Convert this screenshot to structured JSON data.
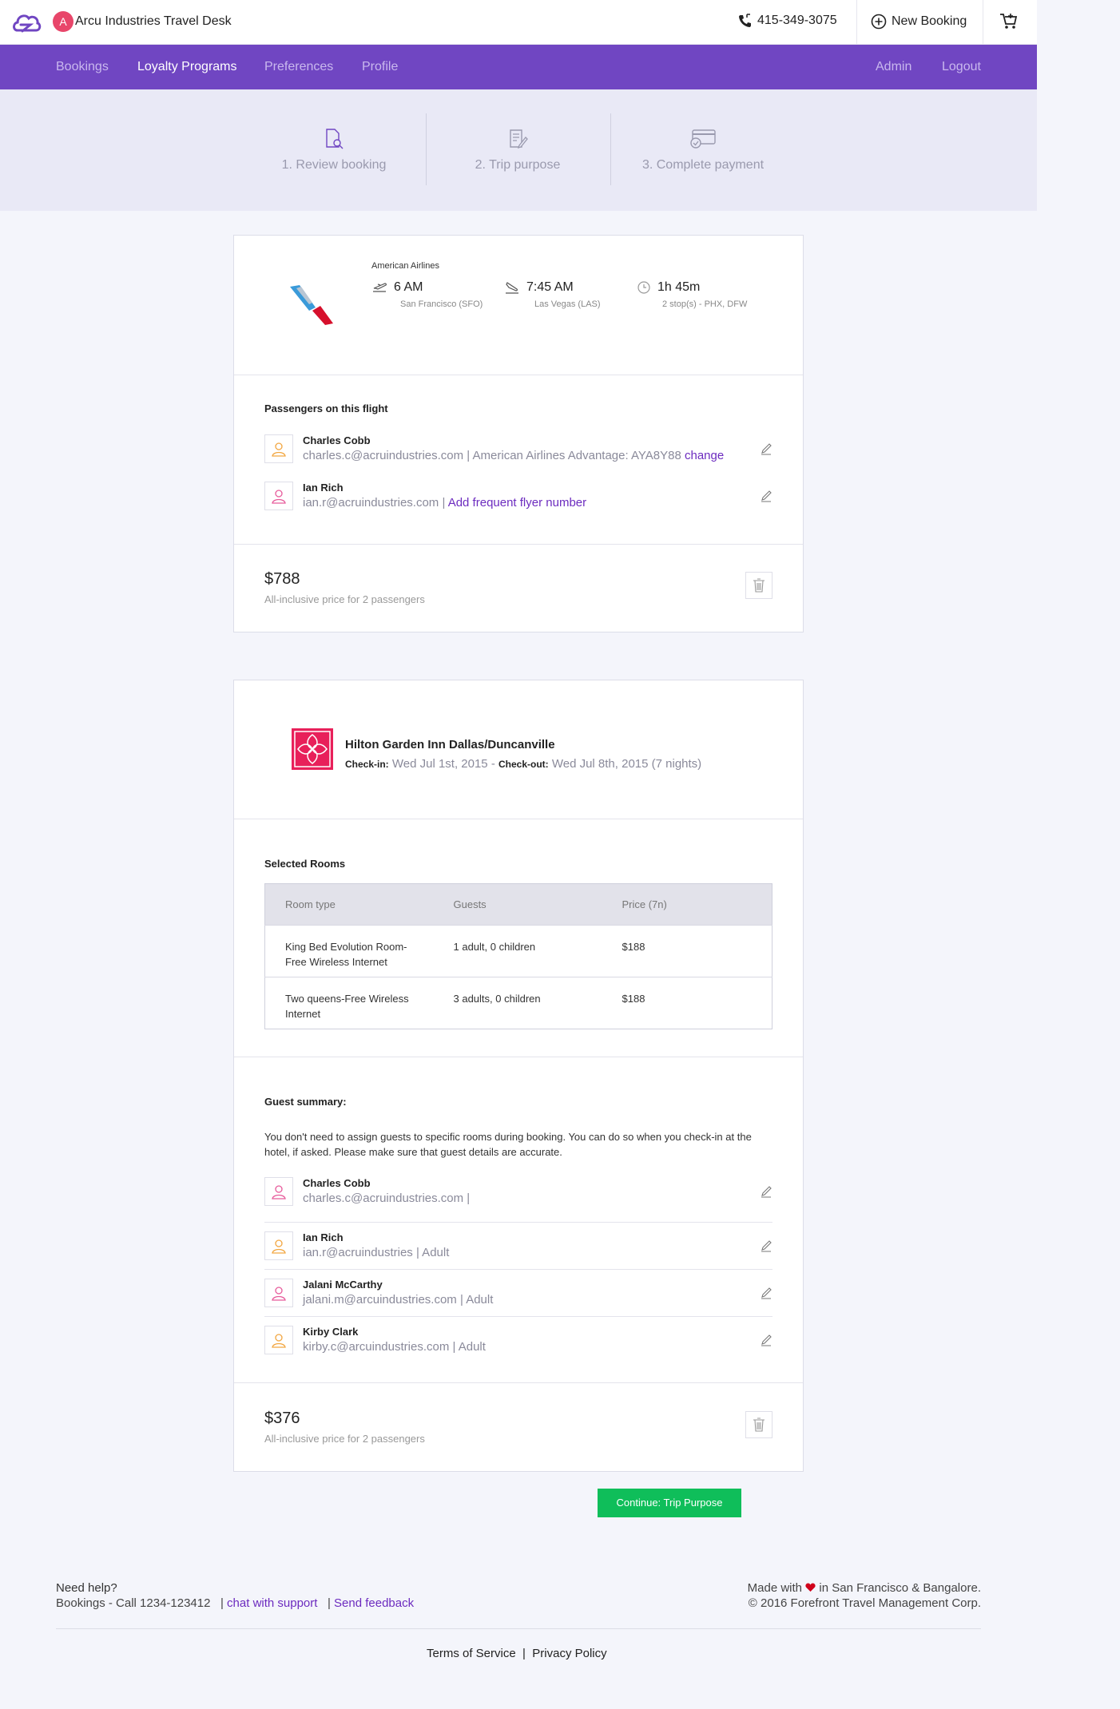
{
  "header": {
    "org_initial": "A",
    "org_name": "Arcu Industries Travel Desk",
    "phone": "415-349-3075",
    "new_booking_label": "New Booking",
    "icons": {
      "logo": "cloud-logo-icon",
      "phone": "phone-icon",
      "new_booking": "plus-circle-icon",
      "cart": "cart-icon"
    }
  },
  "nav": {
    "items": [
      {
        "label": "Bookings",
        "active": false
      },
      {
        "label": "Loyalty Programs",
        "active": true
      },
      {
        "label": "Preferences",
        "active": false
      },
      {
        "label": "Profile",
        "active": false
      }
    ],
    "right_items": [
      {
        "label": "Admin"
      },
      {
        "label": "Logout"
      }
    ],
    "color": "#7046c2"
  },
  "steps": [
    {
      "label": "1. Review booking",
      "icon": "document-search-icon"
    },
    {
      "label": "2. Trip purpose",
      "icon": "clipboard-pencil-icon"
    },
    {
      "label": "3. Complete payment",
      "icon": "credit-card-check-icon"
    }
  ],
  "flight": {
    "airline": "American Airlines",
    "depart_time": "6 AM",
    "depart_place": "San Francisco (SFO)",
    "arrive_time": "7:45 AM",
    "arrive_place": "Las Vegas (LAS)",
    "duration": "1h 45m",
    "stops": "2 stop(s) - PHX, DFW",
    "passengers_title": "Passengers on this flight",
    "passengers": [
      {
        "name": "Charles Cobb",
        "detail": "charles.c@acruindustries.com | American Airlines Advantage: AYA8Y88",
        "link": "change"
      },
      {
        "name": "Ian Rich",
        "detail": "ian.r@acruindustries.com |",
        "link": "Add frequent flyer number"
      }
    ],
    "price": "$788",
    "price_note": "All-inclusive price for 2 passengers"
  },
  "hotel": {
    "name": "Hilton Garden Inn Dallas/Duncanville",
    "checkin_label": "Check-in:",
    "checkin": "Wed Jul 1st, 2015 -",
    "checkout_label": "Check-out:",
    "checkout": "Wed Jul 8th, 2015 (7 nights)",
    "rooms_title": "Selected Rooms",
    "room_headers": [
      "Room type",
      "Guests",
      "Price (7n)"
    ],
    "rooms": [
      {
        "type": "King Bed Evolution Room-Free Wireless Internet",
        "guests": "1 adult, 0 children",
        "price": "$188"
      },
      {
        "type": "Two queens-Free Wireless Internet",
        "guests": "3 adults, 0 children",
        "price": "$188"
      }
    ],
    "guest_summary_title": "Guest summary:",
    "guest_summary_text": "You don't need to assign guests to specific rooms during booking. You can do so when you check-in at the hotel, if asked. Please make sure that guest details are accurate.",
    "guests": [
      {
        "name": "Charles Cobb",
        "detail": "charles.c@acruindustries.com |"
      },
      {
        "name": "Ian Rich",
        "detail": "ian.r@acruindustries | Adult"
      },
      {
        "name": "Jalani McCarthy",
        "detail": "jalani.m@arcuindustries.com | Adult"
      },
      {
        "name": "Kirby Clark",
        "detail": "kirby.c@arcuindustries.com | Adult"
      }
    ],
    "price": "$376",
    "price_note": "All-inclusive price for 2 passengers"
  },
  "continue_label": "Continue: Trip Purpose",
  "footer": {
    "help_title": "Need help?",
    "bookings_call": "Bookings - Call 1234-123412",
    "chat_link": "chat with support",
    "feedback_link": "Send feedback",
    "made_with_prefix": "Made with",
    "made_with_suffix": "in San Francisco & Bangalore.",
    "copyright": "© 2016 Forefront Travel Management Corp.",
    "terms": "Terms of Service",
    "privacy": "Privacy Policy"
  },
  "colors": {
    "accent": "#7046c2",
    "link": "#6c2bbf",
    "button": "#0fbe5a",
    "heart": "#d0021b",
    "hotel_brand": "#e8205a"
  }
}
